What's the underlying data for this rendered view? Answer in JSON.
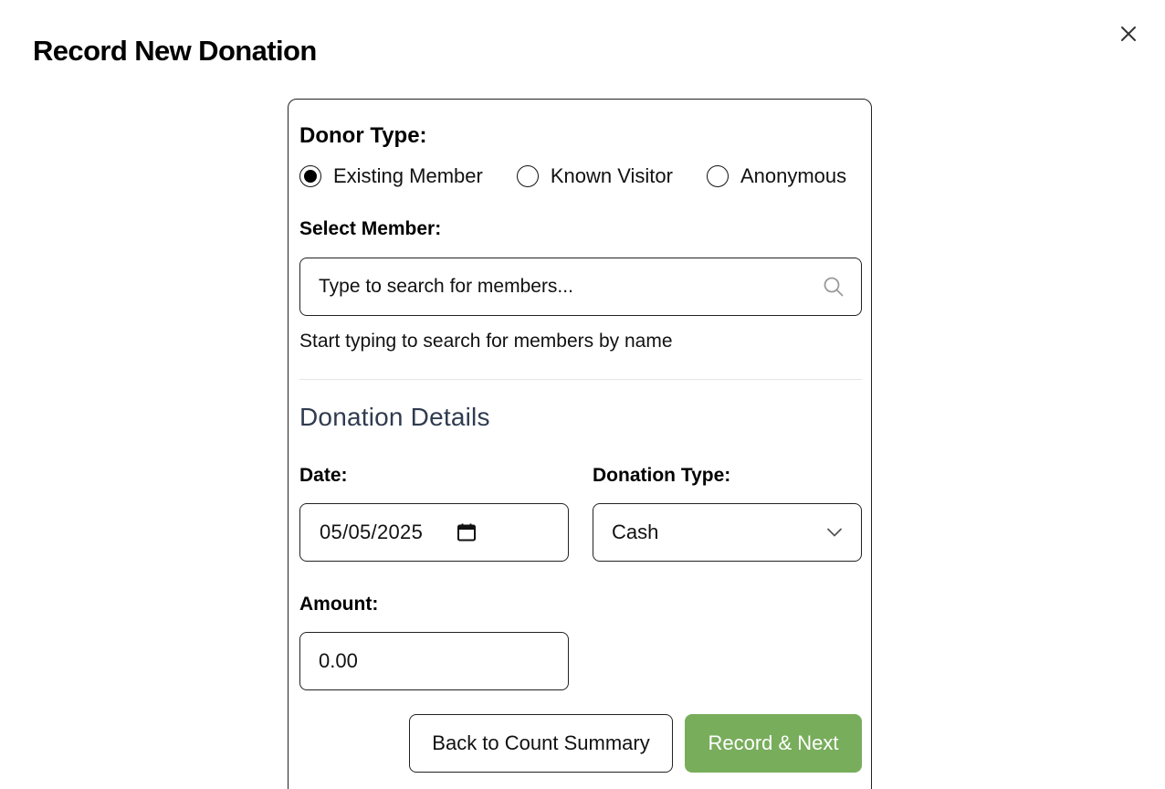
{
  "modal": {
    "title": "Record New Donation"
  },
  "donor_type": {
    "label": "Donor Type:",
    "options": [
      {
        "label": "Existing Member",
        "selected": true
      },
      {
        "label": "Known Visitor",
        "selected": false
      },
      {
        "label": "Anonymous",
        "selected": false
      }
    ]
  },
  "member_search": {
    "label": "Select Member:",
    "placeholder": "Type to search for members...",
    "value": "",
    "helper": "Start typing to search for members by name",
    "icon": "search-icon"
  },
  "donation_details": {
    "title": "Donation Details",
    "date": {
      "label": "Date:",
      "value": "05/05/2025",
      "icon": "calendar-icon"
    },
    "donation_type": {
      "label": "Donation Type:",
      "value": "Cash",
      "icon": "chevron-down-icon"
    },
    "amount": {
      "label": "Amount:",
      "value": "0.00"
    }
  },
  "actions": {
    "back_label": "Back to Count Summary",
    "record_label": "Record & Next"
  },
  "colors": {
    "primary_button": "#78ad5c",
    "section_title": "#2f3b4f",
    "border": "#222222"
  }
}
